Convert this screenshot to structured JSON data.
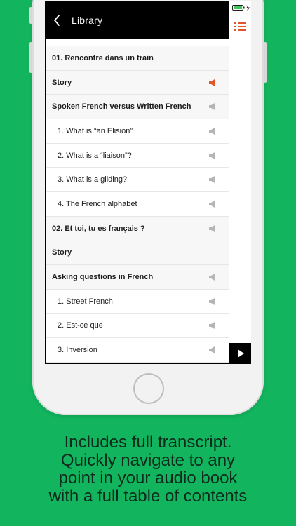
{
  "nav": {
    "back_label": "Library"
  },
  "toc": [
    {
      "label": "01. Rencontre dans un train",
      "level": "section",
      "audio": "none"
    },
    {
      "label": "Story",
      "level": "section",
      "audio": "playing"
    },
    {
      "label": "Spoken French versus Written French",
      "level": "section",
      "audio": "available"
    },
    {
      "label": "1. What is “an Elision”",
      "level": "item",
      "audio": "available"
    },
    {
      "label": "2. What is a “liaison”?",
      "level": "item",
      "audio": "available"
    },
    {
      "label": "3. What is a gliding?",
      "level": "item",
      "audio": "available"
    },
    {
      "label": "4. The French alphabet",
      "level": "item",
      "audio": "available"
    },
    {
      "label": "02. Et toi, tu es français ?",
      "level": "section",
      "audio": "available"
    },
    {
      "label": "Story",
      "level": "section",
      "audio": "none"
    },
    {
      "label": "Asking questions in French",
      "level": "section",
      "audio": "available"
    },
    {
      "label": "1. Street French",
      "level": "item",
      "audio": "available"
    },
    {
      "label": "2. Est-ce que",
      "level": "item",
      "audio": "available"
    },
    {
      "label": "3. Inversion",
      "level": "item",
      "audio": "available"
    }
  ],
  "icons": {
    "back": "chevron-left-icon",
    "menu": "list-menu-icon",
    "play": "play-icon",
    "speaker": "speaker-icon",
    "battery": "battery-icon"
  },
  "colors": {
    "background": "#12b55e",
    "accent": "#e0562b",
    "speaker_inactive": "#b5b5b5",
    "battery": "#3cc85a",
    "caption_text": "#0d2b1d"
  },
  "caption": {
    "line1": "Includes full transcript.",
    "line2": "Quickly navigate to any",
    "line3": "point in your audio book",
    "line4": "with a full table of contents"
  }
}
